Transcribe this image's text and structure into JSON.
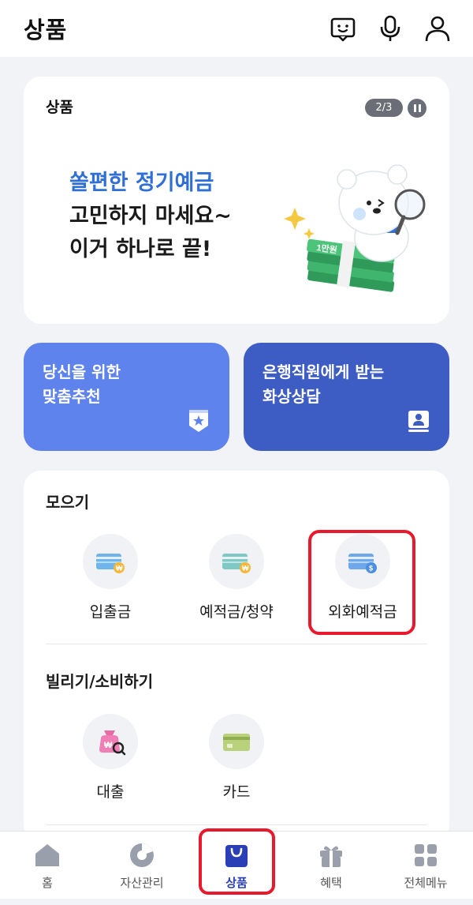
{
  "header": {
    "title": "상품",
    "icons": [
      "chatbot-icon",
      "microphone-icon",
      "user-icon"
    ]
  },
  "banner": {
    "label": "상품",
    "pager": "2/3",
    "line1": "쏠편한 정기예금",
    "line2": "고민하지 마세요~",
    "line3": "이거 하나로 끝!",
    "money_text": "1만원"
  },
  "tiles": [
    {
      "line1": "당신을 위한",
      "line2": "맞춤추천",
      "icon": "recommend-badge-icon"
    },
    {
      "line1": "은행직원에게 받는",
      "line2": "화상상담",
      "icon": "video-consult-icon"
    }
  ],
  "save_section": {
    "title": "모으기",
    "items": [
      {
        "label": "입출금",
        "icon": "deposit-card-icon"
      },
      {
        "label": "예적금/청약",
        "icon": "savings-card-icon"
      },
      {
        "label": "외화예적금",
        "icon": "foreign-currency-card-icon"
      }
    ]
  },
  "borrow_section": {
    "title": "빌리기/소비하기",
    "items": [
      {
        "label": "대출",
        "icon": "loan-bag-icon"
      },
      {
        "label": "카드",
        "icon": "credit-card-icon"
      }
    ]
  },
  "nav": {
    "items": [
      {
        "label": "홈",
        "icon": "home-icon"
      },
      {
        "label": "자산관리",
        "icon": "pie-chart-icon"
      },
      {
        "label": "상품",
        "icon": "shopping-bag-icon"
      },
      {
        "label": "혜택",
        "icon": "gift-icon"
      },
      {
        "label": "전체메뉴",
        "icon": "grid-menu-icon"
      }
    ],
    "active_index": 2
  },
  "colors": {
    "accent_blue": "#2f6fd6",
    "tile_light": "#5f83ed",
    "tile_dark": "#3d5cc4",
    "highlight_red": "#e8192c",
    "nav_active": "#2a3fb5"
  }
}
